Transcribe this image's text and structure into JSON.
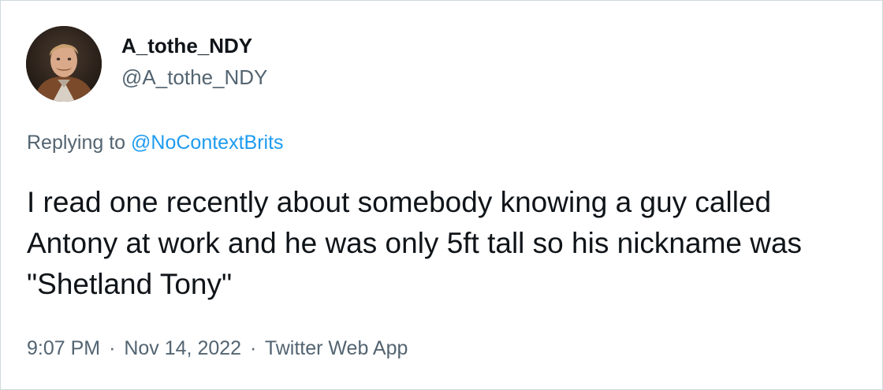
{
  "author": {
    "display_name": "A_tothe_NDY",
    "handle": "@A_tothe_NDY",
    "avatar_icon": "user-avatar-photo"
  },
  "reply": {
    "prefix": "Replying to",
    "mention": "@NoContextBrits"
  },
  "tweet": {
    "text": "I read one recently about somebody knowing a guy called Antony at work and he was only 5ft tall so his nickname was \"Shetland Tony\""
  },
  "meta": {
    "time": "9:07 PM",
    "separator": "·",
    "date": "Nov 14, 2022",
    "source": "Twitter Web App"
  },
  "colors": {
    "text_primary": "#0f1419",
    "text_secondary": "#536471",
    "link": "#1d9bf0",
    "border": "#cfd9de"
  }
}
